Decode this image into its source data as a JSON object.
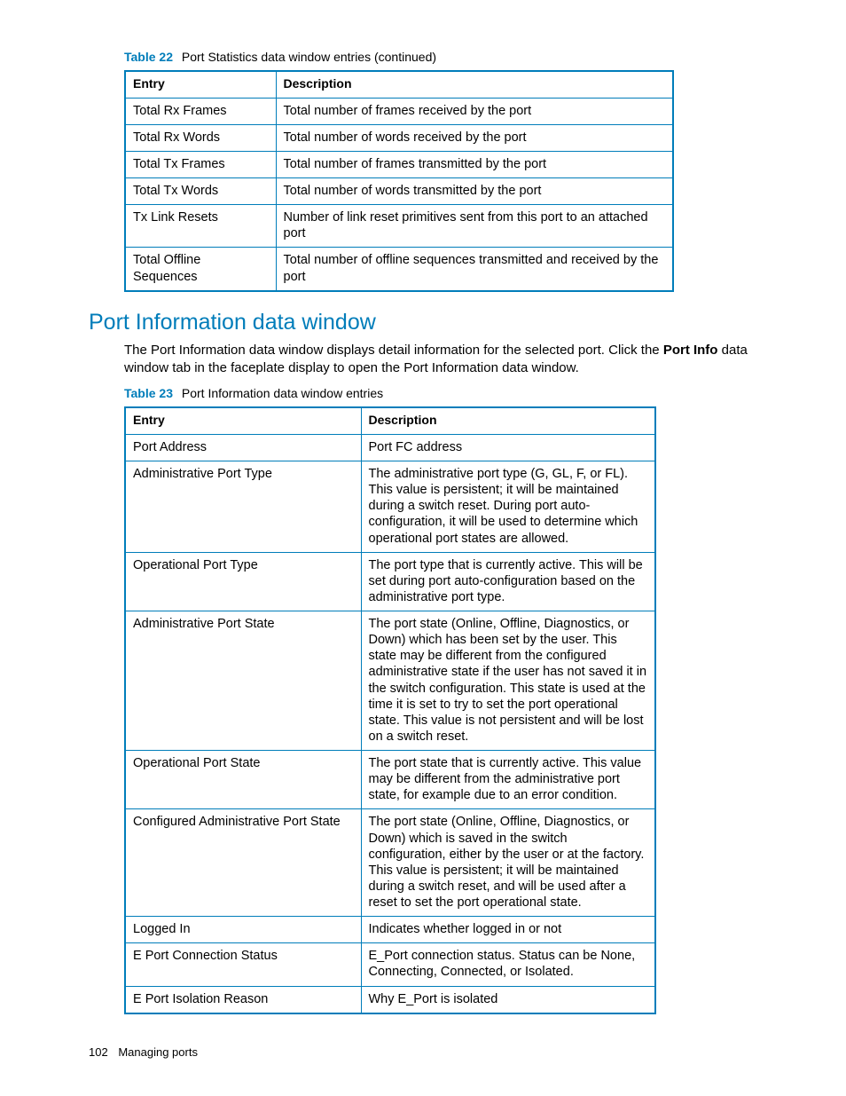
{
  "table22": {
    "caption_label": "Table 22",
    "caption_title": "Port Statistics data window entries  (continued)",
    "headers": {
      "entry": "Entry",
      "desc": "Description"
    },
    "rows": [
      {
        "entry": "Total Rx Frames",
        "desc": "Total number of frames received by the port"
      },
      {
        "entry": "Total Rx Words",
        "desc": "Total number of words received by the port"
      },
      {
        "entry": "Total Tx Frames",
        "desc": "Total number of frames transmitted by the port"
      },
      {
        "entry": "Total Tx Words",
        "desc": "Total number of words transmitted by the port"
      },
      {
        "entry": "Tx Link Resets",
        "desc": "Number of link reset primitives sent from this port to an attached port"
      },
      {
        "entry": "Total Offline Sequences",
        "desc": "Total number of offline sequences transmitted and received by the port"
      }
    ]
  },
  "section": {
    "heading": "Port Information data window",
    "para_before": "The Port Information data window displays detail information for the selected port. Click the ",
    "para_bold": "Port Info",
    "para_after": " data window tab in the faceplate display to open the Port Information data window."
  },
  "table23": {
    "caption_label": "Table 23",
    "caption_title": "Port Information data window entries",
    "headers": {
      "entry": "Entry",
      "desc": "Description"
    },
    "rows": [
      {
        "entry": "Port Address",
        "desc": "Port FC address"
      },
      {
        "entry": "Administrative Port Type",
        "desc": "The administrative port type (G, GL, F, or FL). This value is persistent; it will be maintained during a switch reset. During port auto-configuration, it will be used to determine which operational port states are allowed."
      },
      {
        "entry": "Operational Port Type",
        "desc": "The port type that is currently active. This will be set during port auto-configuration based on the administrative port type."
      },
      {
        "entry": "Administrative Port State",
        "desc": "The port state (Online, Offline, Diagnostics, or Down) which has been set by the user. This state may be different from the configured administrative state if the user has not saved it in the switch configuration. This state is used at the time it is set to try to set the port operational state. This value is not persistent and will be lost on a switch reset."
      },
      {
        "entry": "Operational Port State",
        "desc": "The port state that is currently active. This value may be different from the administrative port state, for example due to an error condition."
      },
      {
        "entry": "Configured Administrative Port State",
        "desc": "The port state (Online, Offline, Diagnostics, or Down) which is saved in the switch configuration, either by the user or at the factory. This value is persistent; it will be maintained during a switch reset, and will be used after a reset to set the port operational state."
      },
      {
        "entry": "Logged In",
        "desc": "Indicates whether logged in or not"
      },
      {
        "entry": "E Port Connection Status",
        "desc": "E_Port connection status. Status can be None, Connecting, Connected, or Isolated."
      },
      {
        "entry": "E Port Isolation Reason",
        "desc": "Why E_Port is isolated"
      }
    ]
  },
  "footer": {
    "page_number": "102",
    "chapter": "Managing ports"
  }
}
